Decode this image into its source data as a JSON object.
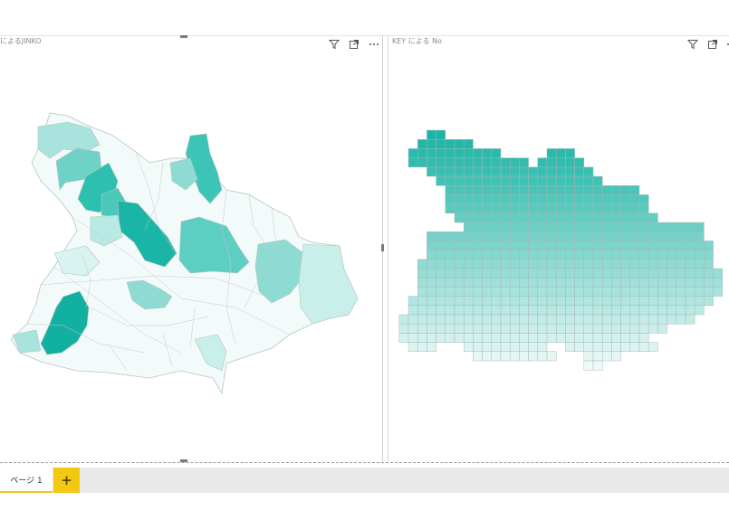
{
  "visuals": [
    {
      "title": "によるJINKO",
      "icons": [
        "filter-icon",
        "focus-mode-icon",
        "more-options-icon"
      ]
    },
    {
      "title": "KEY による No",
      "icons": [
        "filter-icon",
        "focus-mode-icon",
        "more-options-icon"
      ]
    }
  ],
  "page_tabs": {
    "active_label": "ページ 1",
    "add_label": "+"
  },
  "colors": {
    "accent": "#1ab5a6",
    "light": "#e6f7f5",
    "tab_yellow": "#f2c811"
  }
}
